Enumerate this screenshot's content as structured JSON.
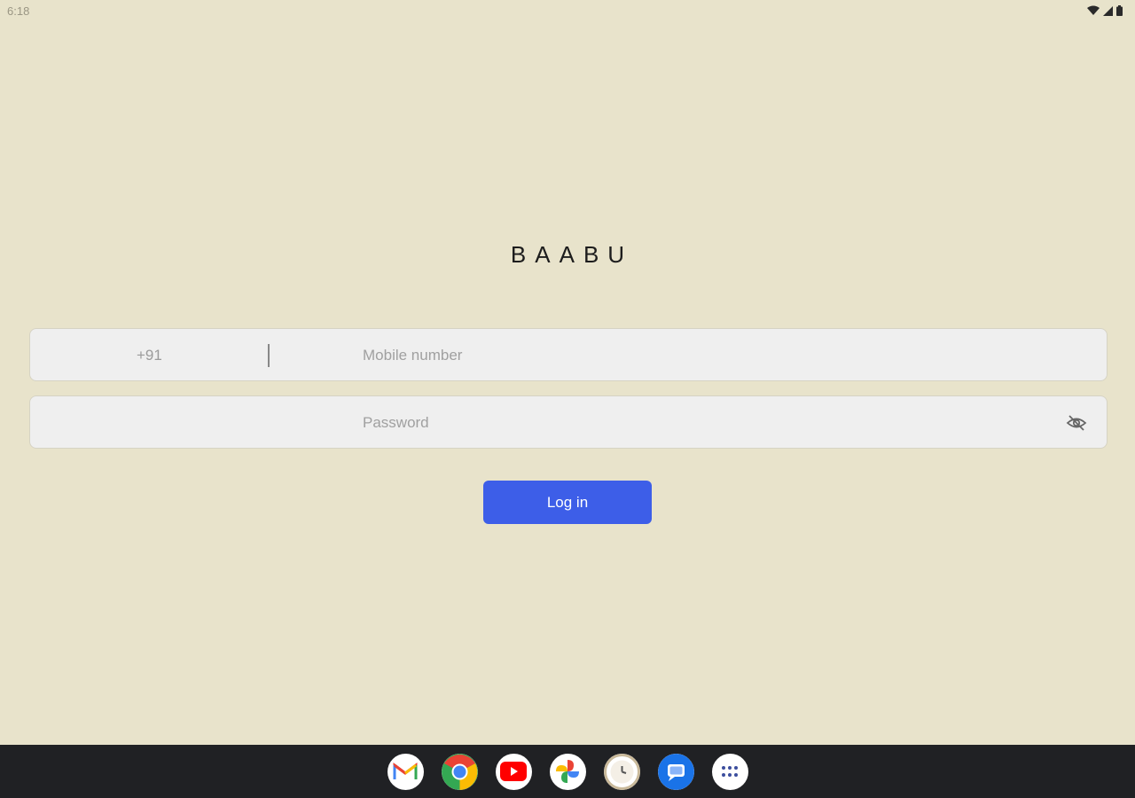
{
  "status_bar": {
    "time": "6:18"
  },
  "brand": {
    "title": "BAABU"
  },
  "form": {
    "country_code": "+91",
    "mobile_placeholder": "Mobile number",
    "password_placeholder": "Password",
    "login_label": "Log in"
  },
  "dock": {
    "apps": [
      "gmail-icon",
      "chrome-icon",
      "youtube-icon",
      "photos-icon",
      "clock-icon",
      "messages-icon",
      "app-drawer-icon"
    ]
  },
  "colors": {
    "background": "#e8e3cb",
    "accent": "#3d5ee8",
    "dock": "#202124"
  }
}
